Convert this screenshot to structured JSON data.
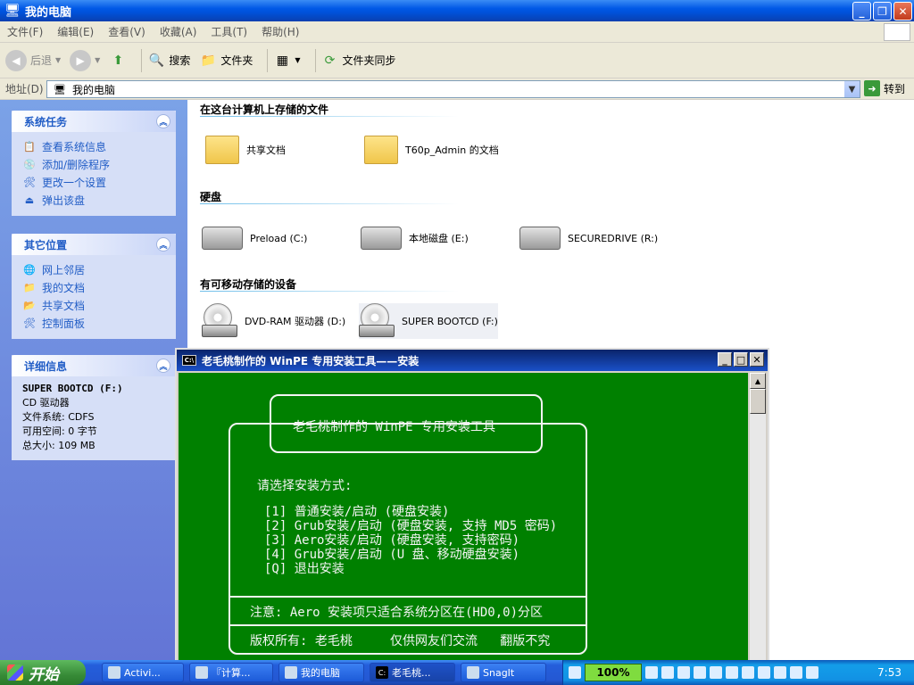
{
  "window": {
    "title": "我的电脑"
  },
  "menu": [
    "文件(F)",
    "编辑(E)",
    "查看(V)",
    "收藏(A)",
    "工具(T)",
    "帮助(H)"
  ],
  "toolbar": {
    "back": "后退",
    "search": "搜索",
    "folders": "文件夹",
    "sync": "文件夹同步"
  },
  "address": {
    "label": "地址(D)",
    "value": "我的电脑",
    "go": "转到"
  },
  "tasks_panel": {
    "title": "系统任务",
    "items": [
      "查看系统信息",
      "添加/删除程序",
      "更改一个设置",
      "弹出该盘"
    ]
  },
  "places_panel": {
    "title": "其它位置",
    "items": [
      "网上邻居",
      "我的文档",
      "共享文档",
      "控制面板"
    ]
  },
  "details_panel": {
    "title": "详细信息",
    "name": "SUPER BOOTCD (F:)",
    "type": "CD 驱动器",
    "fs": "文件系统: CDFS",
    "free": "可用空间: 0 字节",
    "total": "总大小: 109 MB"
  },
  "sections": {
    "stored": "在这台计算机上存储的文件",
    "drives": "硬盘",
    "removable": "有可移动存储的设备"
  },
  "stored_items": [
    "共享文档",
    "T60p_Admin 的文档"
  ],
  "drive_items": [
    "Preload (C:)",
    "本地磁盘 (E:)",
    "SECUREDRIVE (R:)"
  ],
  "removable_items": [
    "DVD-RAM 驱动器 (D:)",
    "SUPER BOOTCD (F:)"
  ],
  "cmd": {
    "title": "老毛桃制作的 WinPE 专用安装工具——安装",
    "header": "老毛桃制作的 WinPE 专用安装工具",
    "prompt": "请选择安装方式:",
    "options": [
      "[1] 普通安装/启动 (硬盘安装)",
      "[2] Grub安装/启动 (硬盘安装, 支持 MD5 密码)",
      "[3] Aero安装/启动 (硬盘安装, 支持密码)",
      "[4] Grub安装/启动 (U 盘、移动硬盘安装)",
      "[Q] 退出安装"
    ],
    "note": "注意: Aero 安装项只适合系统分区在(HD0,0)分区",
    "copyright": "版权所有: 老毛桃     仅供网友们交流   翻版不究"
  },
  "taskbar": {
    "start": "开始",
    "tasks": [
      "Activi...",
      "『计算...",
      "我的电脑",
      "老毛桃...",
      "SnagIt"
    ],
    "zoom": "100%",
    "clock": "7:53"
  }
}
